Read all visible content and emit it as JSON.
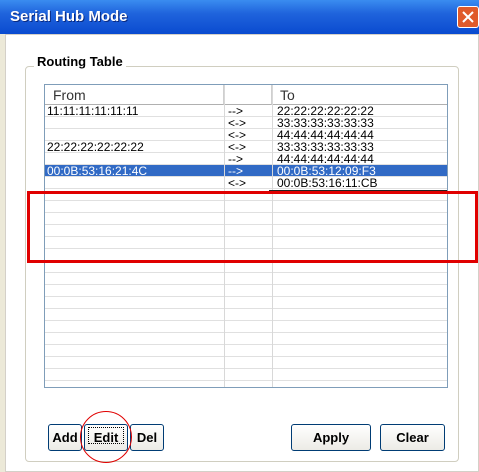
{
  "window": {
    "title": "Serial Hub Mode"
  },
  "group": {
    "label": "Routing Table"
  },
  "table": {
    "headers": [
      "From",
      "",
      "To"
    ],
    "rows": [
      {
        "from": "11:11:11:11:11:11",
        "dir": "-->",
        "to": "22:22:22:22:22:22"
      },
      {
        "from": "",
        "dir": "<->",
        "to": "33:33:33:33:33:33"
      },
      {
        "from": "",
        "dir": "<->",
        "to": "44:44:44:44:44:44"
      },
      {
        "from": "22:22:22:22:22:22",
        "dir": "<->",
        "to": "33:33:33:33:33:33"
      },
      {
        "from": "",
        "dir": "-->",
        "to": "44:44:44:44:44:44"
      },
      {
        "from": "00:0B:53:16:21:4C",
        "dir": "-->",
        "to": "00:0B:53:12:09:F3",
        "selected": true
      },
      {
        "from": "",
        "dir": "<->",
        "to": "00:0B:53:16:11:CB"
      }
    ]
  },
  "buttons": {
    "add": "Add",
    "edit": "Edit",
    "del": "Del",
    "apply": "Apply",
    "clear": "Clear"
  },
  "colors": {
    "selection": "#316ac5",
    "annotation": "#e00000",
    "title_bar": "#0a4bd0"
  },
  "icons": {
    "close": "close-icon"
  }
}
